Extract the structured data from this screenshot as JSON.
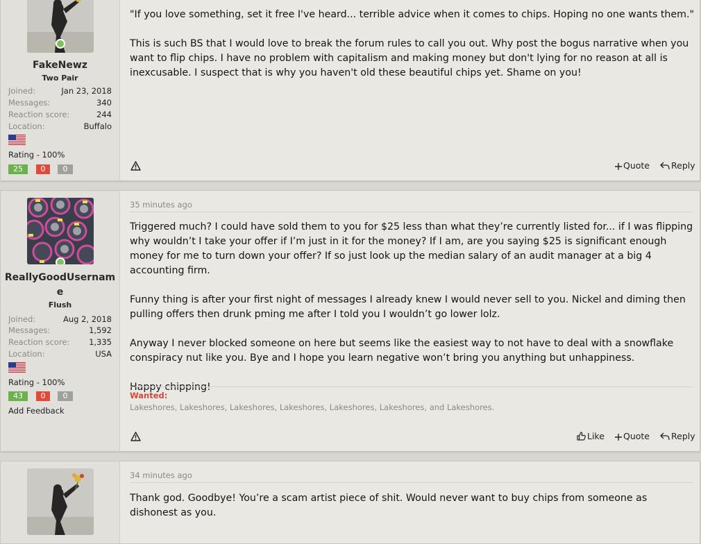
{
  "posts": [
    {
      "user": {
        "name": "FakeNewz",
        "title": "Two Pair",
        "stats": [
          {
            "label": "Joined:",
            "value": "Jan 23, 2018"
          },
          {
            "label": "Messages:",
            "value": "340"
          },
          {
            "label": "Reaction score:",
            "value": "244"
          },
          {
            "label": "Location:",
            "value": "Buffalo"
          }
        ],
        "rating": "Rating - 100%",
        "feedback": {
          "positive": "25",
          "negative": "0",
          "neutral": "0"
        }
      },
      "paragraphs": [
        "\"If you love something, set it free I've heard... terrible advice when it comes to chips. Hoping no one wants them.\"",
        "This is such BS that I would love to break the forum rules to call you out. Why post the bogus narrative when you want to flip chips. I have no problem with capitalism and making money but don't lying for no reason at all is inexcusable. I suspect that is why you haven't old these beautiful chips yet. Shame on you!"
      ],
      "actions": {
        "quote": "Quote",
        "reply": "Reply"
      }
    },
    {
      "time": "35 minutes ago",
      "user": {
        "name": "ReallyGoodUsername",
        "title": "Flush",
        "stats": [
          {
            "label": "Joined:",
            "value": "Aug 2, 2018"
          },
          {
            "label": "Messages:",
            "value": "1,592"
          },
          {
            "label": "Reaction score:",
            "value": "1,335"
          },
          {
            "label": "Location:",
            "value": "USA"
          }
        ],
        "rating": "Rating - 100%",
        "feedback": {
          "positive": "43",
          "negative": "0",
          "neutral": "0"
        },
        "add_feedback": "Add Feedback"
      },
      "paragraphs": [
        "Triggered much? I could have sold them to you for $25 less than what they’re currently listed for... if I was flipping why wouldn’t I take your offer if I’m just in it for the money? If I am, are you saying $25 is significant enough money for me to turn down your offer? If so just look up the median salary of an audit manager at a big 4 accounting firm.",
        "Funny thing is after your first night of messages I already knew I would never sell to you. Nickel and diming then pulling offers then drunk pming me after I told you I wouldn’t go lower lolz.",
        "Anyway I never blocked someone on here but seems like the easiest way to not have to deal with a snowflake conspiracy nut like you. Bye and I hope you learn negative won’t bring you anything but unhappiness.",
        "Happy chipping!"
      ],
      "signature": {
        "label": "Wanted:",
        "text": "Lakeshores, Lakeshores, Lakeshores, Lakeshores, Lakeshores, Lakeshores, and Lakeshores."
      },
      "actions": {
        "like": "Like",
        "quote": "Quote",
        "reply": "Reply"
      }
    },
    {
      "time": "34 minutes ago",
      "paragraphs": [
        "Thank god. Goodbye! You’re a scam artist piece of shit. Would never want to buy chips from someone as dishonest as you."
      ]
    }
  ],
  "colors": {
    "feedback_positive": "#6bb14e",
    "feedback_negative": "#e04a3a",
    "feedback_neutral": "#a0a09c",
    "wanted_label": "#d2473b"
  },
  "icons": [
    "report-icon",
    "plus-icon",
    "reply-icon",
    "thumbs-up-icon",
    "online-status-icon",
    "us-flag-icon"
  ]
}
